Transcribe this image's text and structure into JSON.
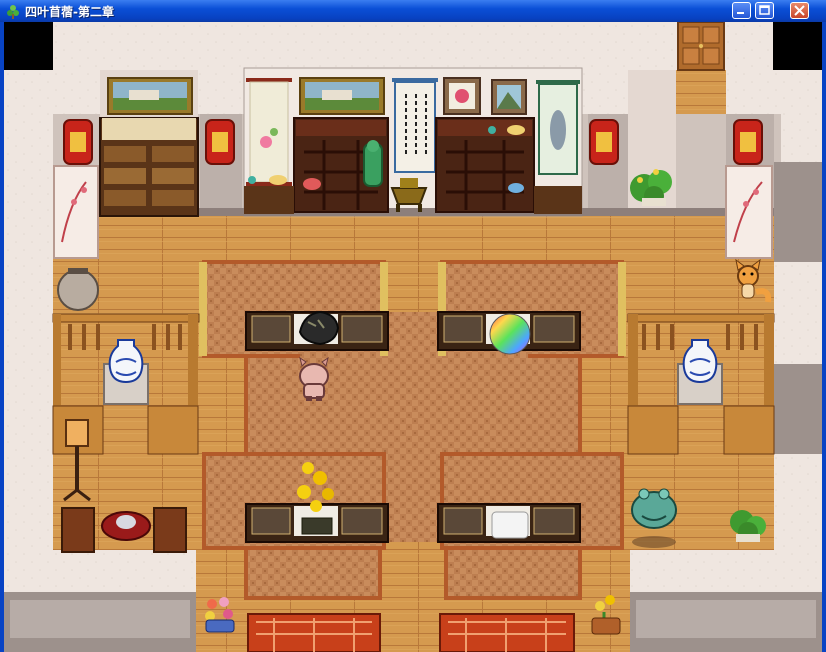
{
  "window": {
    "title": "四叶苜蓿-第二章",
    "buttons": [
      "minimize",
      "maximize",
      "close"
    ]
  },
  "scene": {
    "type": "rpg-map-interior",
    "location_style": "chinese-antique-shop",
    "colors": {
      "floor": "#d59a4f",
      "wall": "#efe6e0",
      "carpet": "#c98c5c",
      "titlebar": "#0a4fd6"
    },
    "objects": [
      "door",
      "landscape-painting",
      "flower-scroll",
      "calligraphy-scroll",
      "flower-frame",
      "mountain-frame",
      "fish-scroll",
      "red-lantern",
      "folding-screen",
      "display-shelf",
      "jade-statue",
      "bronze-censer",
      "clay-jar",
      "blue-white-vase",
      "floor-lamp",
      "tea-table",
      "dark-ore",
      "rainbow-orb",
      "flower-pot",
      "white-cloth",
      "jade-toad",
      "potted-plant",
      "lattice-bench"
    ],
    "characters": [
      "pink-pig-hero",
      "orange-fox-npc"
    ]
  }
}
